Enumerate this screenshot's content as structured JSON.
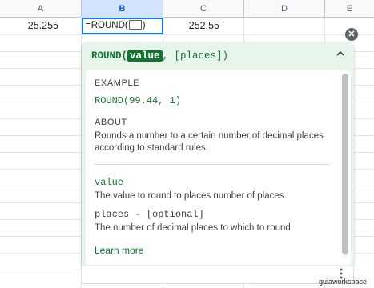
{
  "columns": [
    "A",
    "B",
    "C",
    "D",
    "E"
  ],
  "cells": {
    "a1": "25.255",
    "b1_formula_prefix": "=ROUND(",
    "b1_formula_suffix": ")",
    "c1": "252.55"
  },
  "help": {
    "function_name": "ROUND(",
    "active_arg": "value",
    "rest_args": ", [places])",
    "example_label": "EXAMPLE",
    "example_code": "ROUND(99.44, 1)",
    "about_label": "ABOUT",
    "about_text": "Rounds a number to a certain number of decimal places according to standard rules.",
    "arg1_name": "value",
    "arg1_desc": "The value to round to places number of places.",
    "arg2_name": "places - [optional]",
    "arg2_desc": "The number of decimal places to which to round.",
    "learn_more": "Learn more"
  },
  "icons": {
    "close": "close-circle-icon",
    "collapse": "chevron-up-icon",
    "more": "more-vertical-icon"
  },
  "watermark": "guiaworkspace",
  "colors": {
    "accent_green": "#137333",
    "panel_bg": "#e6f4ea",
    "selection_blue": "#1a73e8"
  }
}
